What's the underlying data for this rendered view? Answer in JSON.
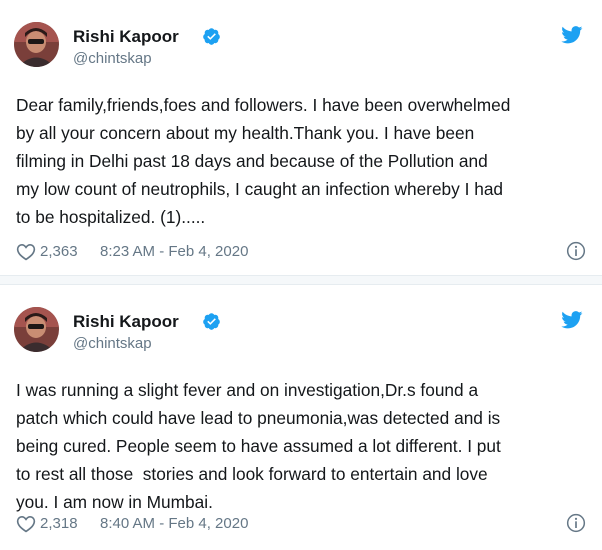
{
  "tweets": [
    {
      "author": "Rishi Kapoor",
      "handle": "@chintskap",
      "text": "Dear family,friends,foes and followers. I have been overwhelmed\nby all your concern about my health.Thank you. I have been\nfilming in Delhi past 18 days and because of the Pollution and\nmy low count of neutrophils, I caught an infection whereby I had\nto be hospitalized. (1).....",
      "likes": "2,363",
      "timestamp": "8:23 AM - Feb 4, 2020"
    },
    {
      "author": "Rishi Kapoor",
      "handle": "@chintskap",
      "text": "I was running a slight fever and on investigation,Dr.s found a\npatch which could have lead to pneumonia,was detected and is\nbeing cured. People seem to have assumed a lot different. I put\nto rest all those  stories and look forward to entertain and love\nyou. I am now in Mumbai.",
      "likes": "2,318",
      "timestamp": "8:40 AM - Feb 4, 2020"
    }
  ],
  "colors": {
    "twitter_blue": "#1da1f2",
    "text": "#14171a",
    "secondary_text": "#657786"
  },
  "icons": [
    "verified-badge-icon",
    "twitter-bird-icon",
    "heart-icon",
    "info-icon"
  ]
}
